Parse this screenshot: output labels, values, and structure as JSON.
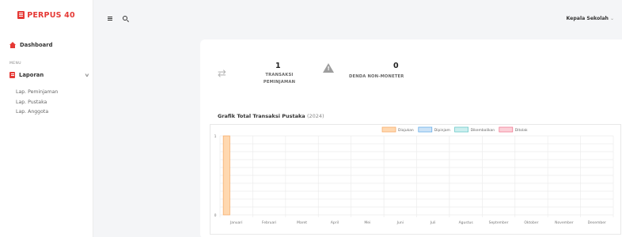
{
  "app": {
    "brand": "PERPUS 40",
    "colors": {
      "accent": "#e53935"
    }
  },
  "sidebar": {
    "dashboard": "Dashboard",
    "menu_label": "MENU",
    "laporan": "Laporan",
    "laporan_icon": "report-icon",
    "submenu": [
      "Lap. Peminjaman",
      "Lap. Pustaka",
      "Lap. Anggota"
    ]
  },
  "header": {
    "user": "Kepala Sekolah"
  },
  "stats": [
    {
      "value": "1",
      "label_line1": "TRANSAKSI",
      "label_line2": "PEMINJAMAN",
      "icon": "exchange-icon"
    },
    {
      "value": "0",
      "label": "DENDA NON-MONETER",
      "icon": "warning-icon"
    }
  ],
  "chart": {
    "title": "Grafik Total Transaksi Pustaka",
    "year": "(2024)"
  },
  "chart_data": {
    "type": "bar",
    "categories": [
      "Januari",
      "Februari",
      "Maret",
      "April",
      "Mei",
      "Juni",
      "Juli",
      "Agustus",
      "September",
      "Oktober",
      "November",
      "Desember"
    ],
    "series": [
      {
        "name": "Diajukan",
        "color": "#ffd8b0",
        "stroke": "#f5a761",
        "values": [
          1,
          0,
          0,
          0,
          0,
          0,
          0,
          0,
          0,
          0,
          0,
          0
        ]
      },
      {
        "name": "Dipinjam",
        "color": "#cce3f7",
        "stroke": "#5aa6e6",
        "values": [
          0,
          0,
          0,
          0,
          0,
          0,
          0,
          0,
          0,
          0,
          0,
          0
        ]
      },
      {
        "name": "Dikembalikan",
        "color": "#ccefef",
        "stroke": "#5cc3c3",
        "values": [
          0,
          0,
          0,
          0,
          0,
          0,
          0,
          0,
          0,
          0,
          0,
          0
        ]
      },
      {
        "name": "Ditolak",
        "color": "#fbd0d8",
        "stroke": "#f0708a",
        "values": [
          0,
          0,
          0,
          0,
          0,
          0,
          0,
          0,
          0,
          0,
          0,
          0
        ]
      }
    ],
    "yticks": [
      "0",
      "1"
    ],
    "ylim": [
      0,
      1
    ],
    "grid": true,
    "legend": "top-center"
  }
}
